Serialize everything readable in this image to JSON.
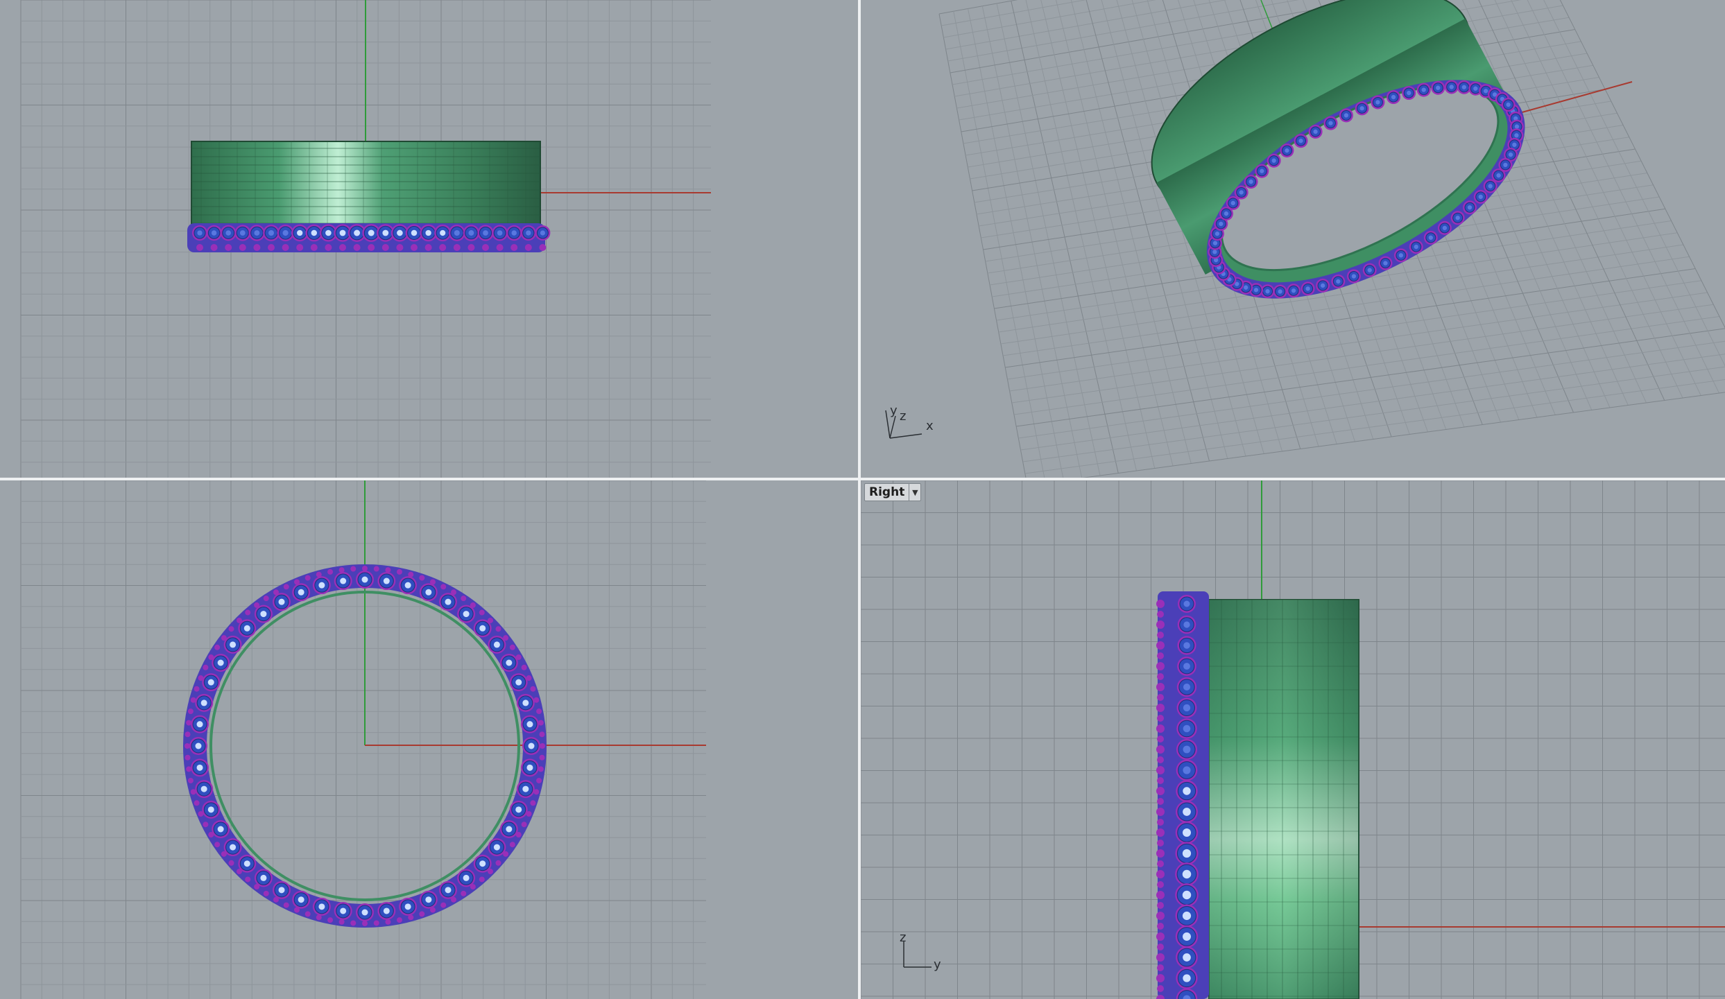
{
  "viewports": {
    "front": {
      "title": ""
    },
    "perspective": {
      "title": "",
      "axis_x": "x",
      "axis_y": "y",
      "axis_z": "z"
    },
    "top": {
      "title": ""
    },
    "right": {
      "title": "Right",
      "axis_y": "y",
      "axis_z": "z",
      "dropdown_icon": "chevron-down-icon"
    }
  },
  "colors": {
    "background": "#9da4aa",
    "grid_minor": "#8e959b",
    "grid_major": "#7e858b",
    "x_axis": "#a83a30",
    "y_axis": "#2f9b3a",
    "ring_body": "#3f8f63",
    "stone_blue": "#2f4fc0",
    "prong_purple": "#9a2fb8"
  }
}
